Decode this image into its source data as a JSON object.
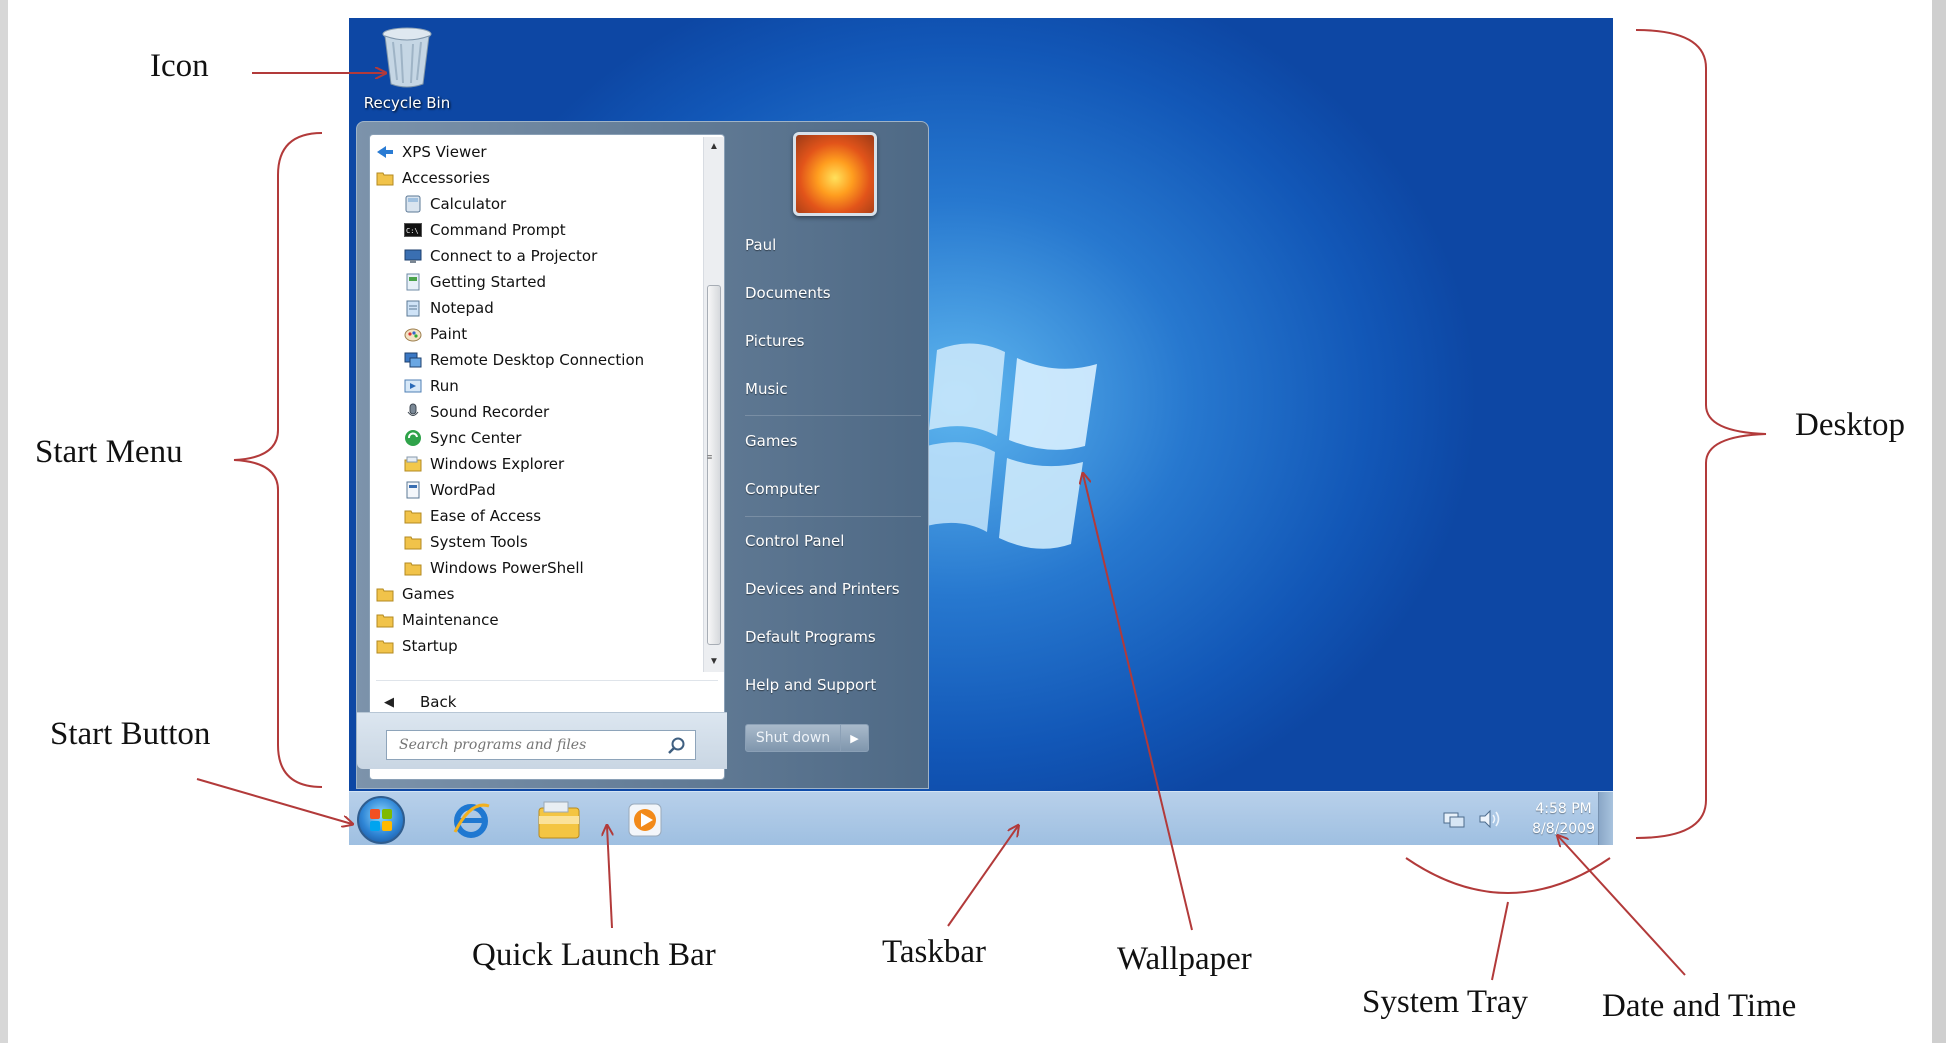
{
  "desktop": {
    "recycle_bin_label": "Recycle Bin"
  },
  "start_menu": {
    "programs": [
      {
        "label": "XPS Viewer",
        "icon": "xps-viewer-icon",
        "level": 0
      },
      {
        "label": "Accessories",
        "icon": "folder-icon",
        "level": 0
      },
      {
        "label": "Calculator",
        "icon": "calculator-icon",
        "level": 1
      },
      {
        "label": "Command Prompt",
        "icon": "command-prompt-icon",
        "level": 1
      },
      {
        "label": "Connect to a Projector",
        "icon": "projector-icon",
        "level": 1
      },
      {
        "label": "Getting Started",
        "icon": "getting-started-icon",
        "level": 1
      },
      {
        "label": "Notepad",
        "icon": "notepad-icon",
        "level": 1
      },
      {
        "label": "Paint",
        "icon": "paint-icon",
        "level": 1
      },
      {
        "label": "Remote Desktop Connection",
        "icon": "remote-desktop-icon",
        "level": 1
      },
      {
        "label": "Run",
        "icon": "run-icon",
        "level": 1
      },
      {
        "label": "Sound Recorder",
        "icon": "microphone-icon",
        "level": 1
      },
      {
        "label": "Sync Center",
        "icon": "sync-icon",
        "level": 1
      },
      {
        "label": "Windows Explorer",
        "icon": "explorer-icon",
        "level": 1
      },
      {
        "label": "WordPad",
        "icon": "wordpad-icon",
        "level": 1
      },
      {
        "label": "Ease of Access",
        "icon": "folder-icon",
        "level": 1
      },
      {
        "label": "System Tools",
        "icon": "folder-icon",
        "level": 1
      },
      {
        "label": "Windows PowerShell",
        "icon": "folder-icon",
        "level": 1
      },
      {
        "label": "Games",
        "icon": "folder-icon",
        "level": 0
      },
      {
        "label": "Maintenance",
        "icon": "folder-icon",
        "level": 0
      },
      {
        "label": "Startup",
        "icon": "folder-icon",
        "level": 0
      }
    ],
    "back_label": "Back",
    "search_placeholder": "Search programs and files",
    "right_items": [
      "Paul",
      "Documents",
      "Pictures",
      "Music",
      "Games",
      "Computer",
      "Control Panel",
      "Devices and Printers",
      "Default Programs",
      "Help and Support"
    ],
    "shutdown_label": "Shut down"
  },
  "taskbar": {
    "quick_launch": [
      "internet-explorer-icon",
      "file-explorer-icon",
      "media-player-icon"
    ],
    "tray_icons": [
      "network-icon",
      "volume-icon"
    ],
    "time": "4:58 PM",
    "date": "8/8/2009"
  },
  "annotations": {
    "icon": "Icon",
    "start_menu": "Start Menu",
    "start_button": "Start Button",
    "quick_launch_bar": "Quick Launch Bar",
    "taskbar": "Taskbar",
    "wallpaper": "Wallpaper",
    "system_tray": "System Tray",
    "date_and_time": "Date and Time",
    "desktop": "Desktop"
  },
  "colors": {
    "annotation_line": "#b23a3a",
    "wallpaper_blue": "#1a62c2",
    "taskbar": "#aac7e6"
  }
}
